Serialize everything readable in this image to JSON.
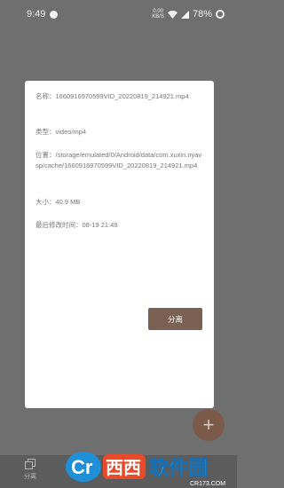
{
  "status_bar": {
    "time": "9:49",
    "net_speed_value": "0.00",
    "net_speed_unit": "KB/S",
    "battery": "78%"
  },
  "dialog": {
    "name_field": "名称：1660916970599VID_20220819_214921.mp4",
    "type_field": "类型：video/mp4",
    "location_field": "位置：/storage/emulated/0/Android/data/com.xuxin.nyavsp/cache/1660916970599VID_20220819_214921.mp4",
    "size_field": "大小：40.9 MB",
    "mtime_field": "最后修改时间：08-19 21:49",
    "separate_button": "分离"
  },
  "fab": {
    "icon": "plus-icon",
    "label": "+"
  },
  "bottom_nav": {
    "items": [
      {
        "label": "分离",
        "icon": "copy-icon"
      }
    ]
  },
  "watermark": {
    "logo_text_cr": "Cr",
    "logo_text_xixi": "西西",
    "logo_text_main": "软件园",
    "url": "CR173.COM"
  },
  "colors": {
    "overlay_bg": "#6f6f6f",
    "accent": "#7b6154",
    "fab": "#7b5a49"
  }
}
